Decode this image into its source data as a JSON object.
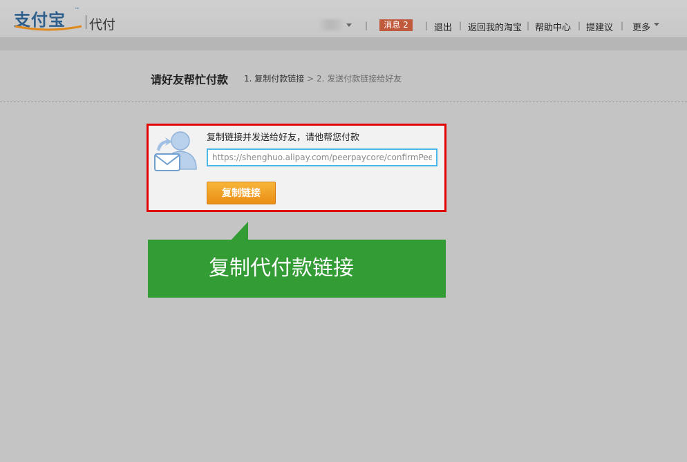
{
  "header": {
    "logo_text": "支付宝",
    "logo_tm": "™",
    "product": "代付",
    "message_label": "消息 2",
    "separator": "|",
    "links": [
      "退出",
      "返回我的淘宝",
      "帮助中心",
      "提建议",
      "更多"
    ]
  },
  "page": {
    "title": "请好友帮忙付款",
    "step_active": "1. 复制付款链接",
    "step_arrow": ">",
    "step_next": "2. 发送付款链接给好友"
  },
  "share_box": {
    "instruction": "复制链接并发送给好友，请他帮您付款",
    "link_value": "https://shenghuo.alipay.com/peerpaycore/confirmPeerPay",
    "copy_button": "复制链接",
    "icon": "share-contact-envelope-icon"
  },
  "callout": {
    "text": "复制代付款链接",
    "color": "#339c35"
  },
  "colors": {
    "highlight_border": "#e00000",
    "button_orange": "#ea8f14",
    "message_badge": "#c05a3d",
    "input_border": "#4ab8e6"
  }
}
